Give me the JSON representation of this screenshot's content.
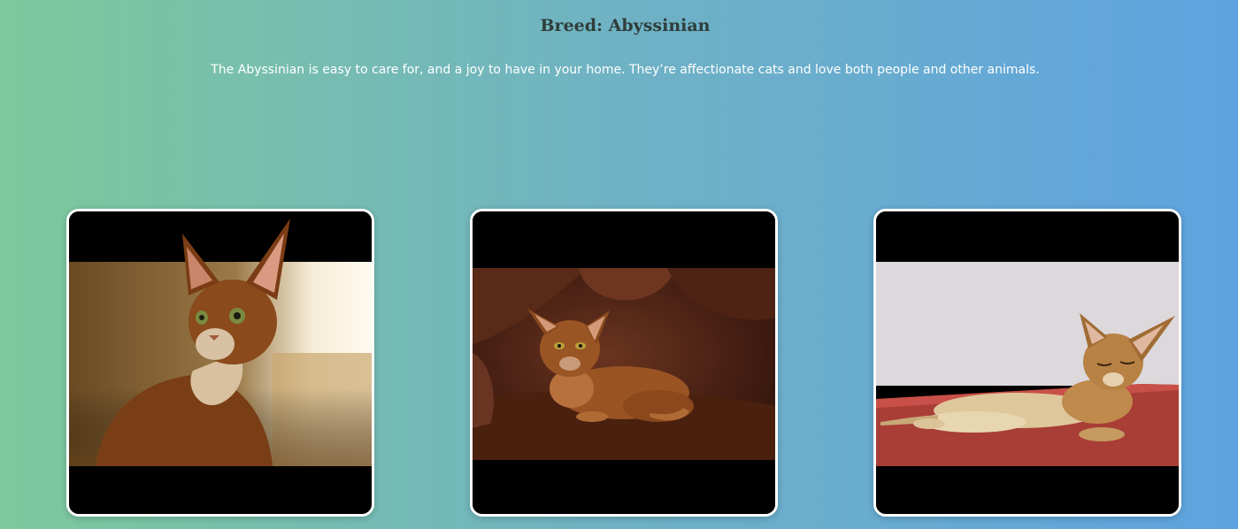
{
  "breed": {
    "title": "Breed: Abyssinian",
    "description": "The Abyssinian is easy to care for, and a joy to have in your home. They’re affectionate cats and love both people and other animals."
  },
  "gallery": {
    "images": [
      {
        "name": "cat-photo-1",
        "subject": "Abyssinian cat sitting, looking up"
      },
      {
        "name": "cat-photo-2",
        "subject": "Abyssinian cat lying on a brown leather couch"
      },
      {
        "name": "cat-photo-3",
        "subject": "Abyssinian kitten lying on a red surface"
      }
    ]
  },
  "colors": {
    "gradient_start": "#7ec89c",
    "gradient_end": "#5ea3e0",
    "card_border": "#ffffff",
    "letterbox": "#000000"
  }
}
